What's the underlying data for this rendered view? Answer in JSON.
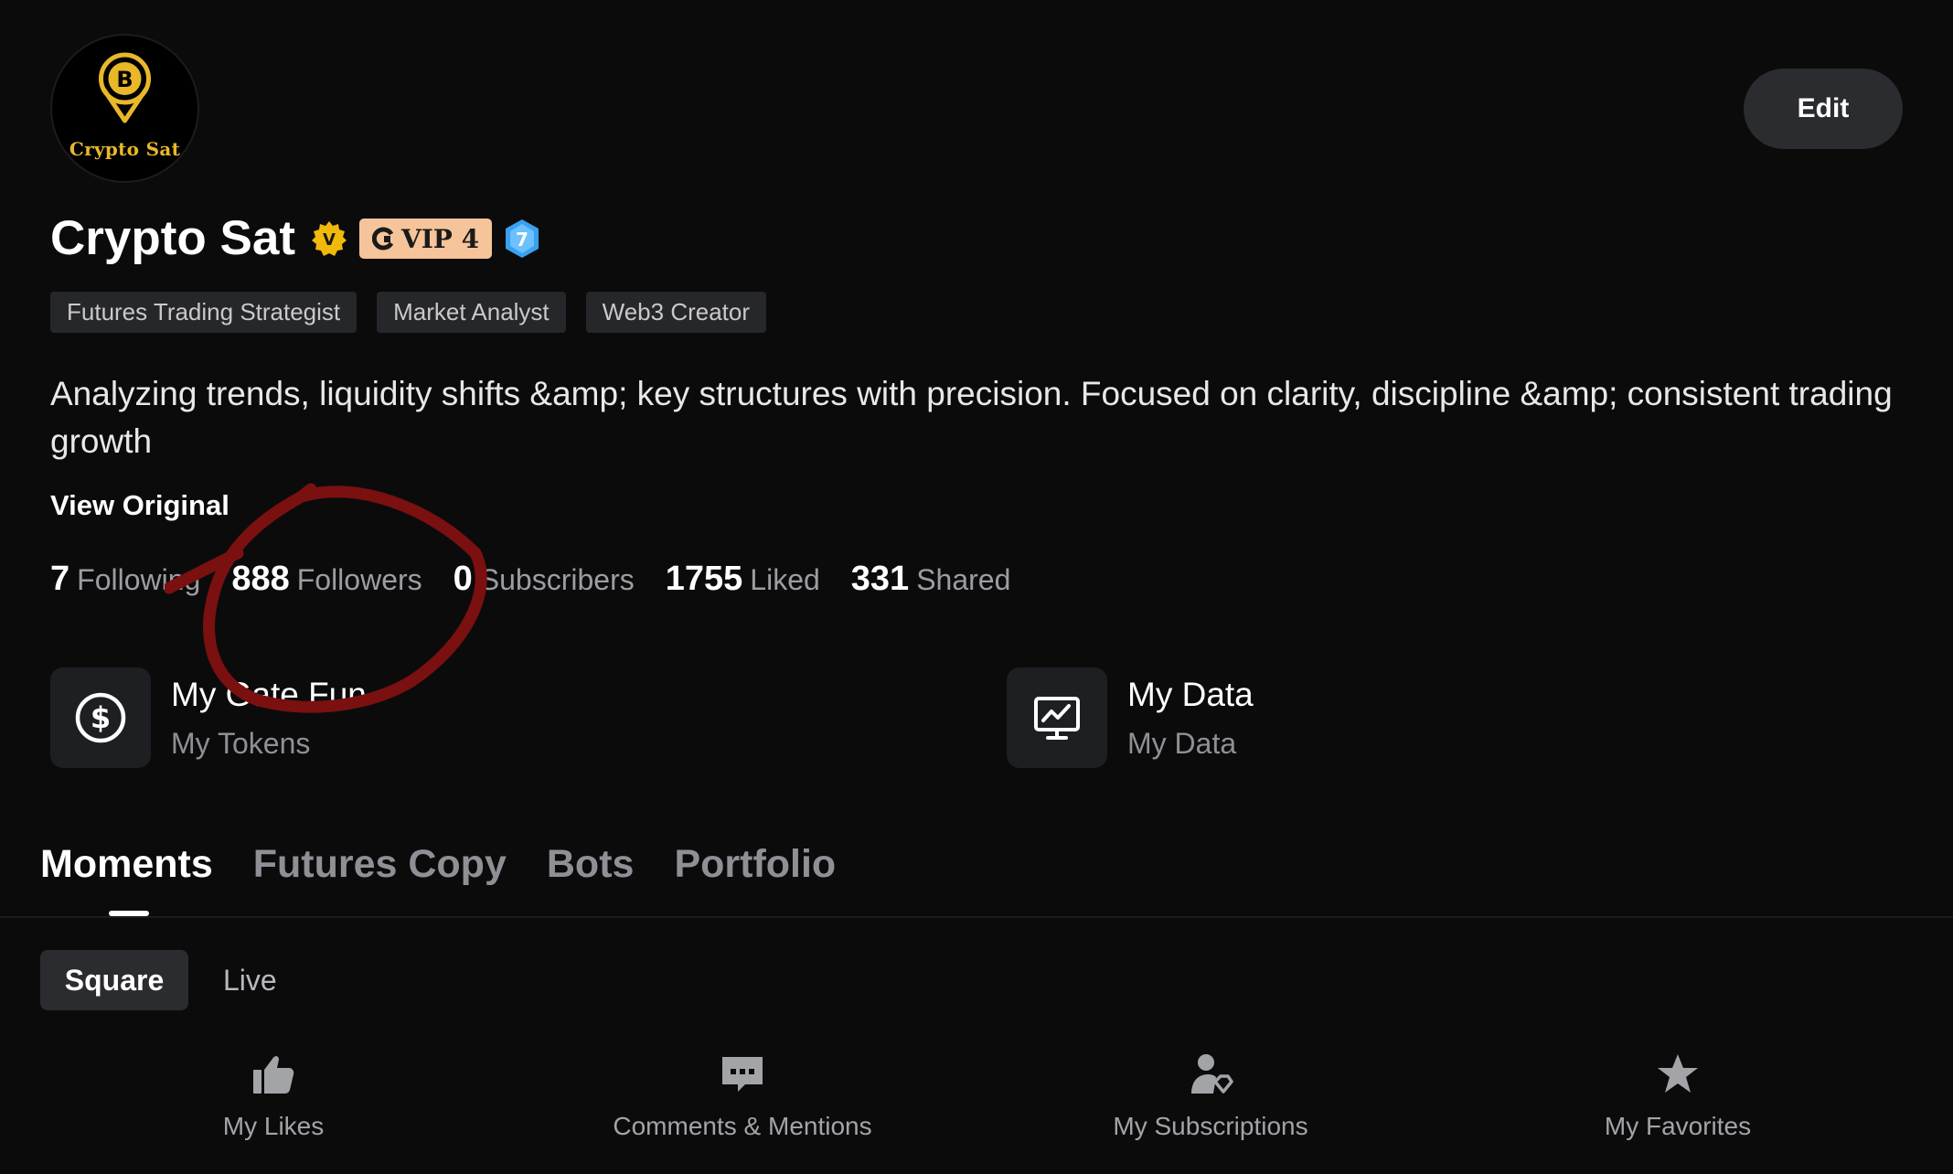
{
  "profile": {
    "avatar_text": "Crypto Sat",
    "name": "Crypto Sat",
    "verified_letter": "V",
    "vip_label": "VIP 4",
    "level": "7",
    "edit_label": "Edit",
    "tags": [
      "Futures Trading Strategist",
      "Market Analyst",
      "Web3 Creator"
    ],
    "bio": "Analyzing trends, liquidity shifts &amp; key structures with precision. Focused on clarity, discipline &amp; consistent trading growth",
    "view_original": "View Original"
  },
  "stats": [
    {
      "num": "7",
      "label": "Following"
    },
    {
      "num": "888",
      "label": "Followers"
    },
    {
      "num": "0",
      "label": "Subscribers"
    },
    {
      "num": "1755",
      "label": "Liked"
    },
    {
      "num": "331",
      "label": "Shared"
    }
  ],
  "cards": [
    {
      "title": "My Gate Fun",
      "subtitle": "My Tokens",
      "icon": "dollar-circle-icon"
    },
    {
      "title": "My Data",
      "subtitle": "My Data",
      "icon": "chart-monitor-icon"
    }
  ],
  "tabs": [
    "Moments",
    "Futures Copy",
    "Bots",
    "Portfolio"
  ],
  "active_tab": "Moments",
  "subtabs": [
    "Square",
    "Live"
  ],
  "active_subtab": "Square",
  "actions": [
    {
      "label": "My Likes",
      "icon": "thumbs-up-icon"
    },
    {
      "label": "Comments & Mentions",
      "icon": "comment-icon"
    },
    {
      "label": "My Subscriptions",
      "icon": "subscription-user-icon"
    },
    {
      "label": "My Favorites",
      "icon": "star-icon"
    }
  ],
  "colors": {
    "background": "#0b0b0c",
    "vip_badge": "#f6c49a",
    "verified_gold": "#f0b90b",
    "level_blue": "#3aa0f0",
    "annotation_red": "#7a1010",
    "avatar_gold": "#e9b829"
  }
}
